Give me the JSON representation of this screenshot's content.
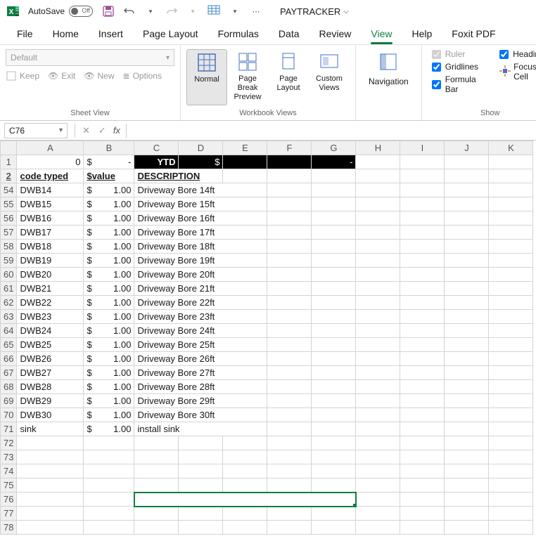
{
  "title": {
    "autosave_label": "AutoSave",
    "autosave_state": "Off",
    "doc_name": "PAYTRACKER"
  },
  "tabs": {
    "file": "File",
    "home": "Home",
    "insert": "Insert",
    "page_layout": "Page Layout",
    "formulas": "Formulas",
    "data": "Data",
    "review": "Review",
    "view": "View",
    "help": "Help",
    "foxit": "Foxit PDF"
  },
  "ribbon": {
    "sheet_view": {
      "dropdown_placeholder": "Default",
      "keep": "Keep",
      "exit": "Exit",
      "new": "New",
      "options": "Options",
      "label": "Sheet View"
    },
    "workbook_views": {
      "normal": "Normal",
      "page_break": "Page Break Preview",
      "page_layout": "Page Layout",
      "custom_views": "Custom Views",
      "label": "Workbook Views"
    },
    "navigation": {
      "btn": "Navigation"
    },
    "show": {
      "ruler": "Ruler",
      "gridlines": "Gridlines",
      "formula_bar": "Formula Bar",
      "headings": "Headings",
      "focus_cell": "Focus Cell",
      "label": "Show"
    }
  },
  "namebox": "C76",
  "columns": [
    "A",
    "B",
    "C",
    "D",
    "E",
    "F",
    "G",
    "H",
    "I",
    "J",
    "K"
  ],
  "row1": {
    "a": "0",
    "b_sym": "$",
    "b_val": "-",
    "ytd": "YTD",
    "ytd_sym": "$",
    "ytd_dash": "-"
  },
  "row2": {
    "code": "code typed",
    "value": "$value",
    "desc": "DESCRIPTION"
  },
  "data_rows": [
    {
      "row": 54,
      "code": "DWB14",
      "sym": "$",
      "val": "1.00",
      "desc": "Driveway Bore 14ft"
    },
    {
      "row": 55,
      "code": "DWB15",
      "sym": "$",
      "val": "1.00",
      "desc": "Driveway Bore 15ft"
    },
    {
      "row": 56,
      "code": "DWB16",
      "sym": "$",
      "val": "1.00",
      "desc": "Driveway Bore 16ft"
    },
    {
      "row": 57,
      "code": "DWB17",
      "sym": "$",
      "val": "1.00",
      "desc": "Driveway Bore 17ft"
    },
    {
      "row": 58,
      "code": "DWB18",
      "sym": "$",
      "val": "1.00",
      "desc": "Driveway Bore 18ft"
    },
    {
      "row": 59,
      "code": "DWB19",
      "sym": "$",
      "val": "1.00",
      "desc": "Driveway Bore 19ft"
    },
    {
      "row": 60,
      "code": "DWB20",
      "sym": "$",
      "val": "1.00",
      "desc": "Driveway Bore 20ft"
    },
    {
      "row": 61,
      "code": "DWB21",
      "sym": "$",
      "val": "1.00",
      "desc": "Driveway Bore 21ft"
    },
    {
      "row": 62,
      "code": "DWB22",
      "sym": "$",
      "val": "1.00",
      "desc": "Driveway Bore 22ft"
    },
    {
      "row": 63,
      "code": "DWB23",
      "sym": "$",
      "val": "1.00",
      "desc": "Driveway Bore 23ft"
    },
    {
      "row": 64,
      "code": "DWB24",
      "sym": "$",
      "val": "1.00",
      "desc": "Driveway Bore 24ft"
    },
    {
      "row": 65,
      "code": "DWB25",
      "sym": "$",
      "val": "1.00",
      "desc": "Driveway Bore 25ft"
    },
    {
      "row": 66,
      "code": "DWB26",
      "sym": "$",
      "val": "1.00",
      "desc": "Driveway Bore 26ft"
    },
    {
      "row": 67,
      "code": "DWB27",
      "sym": "$",
      "val": "1.00",
      "desc": "Driveway Bore 27ft"
    },
    {
      "row": 68,
      "code": "DWB28",
      "sym": "$",
      "val": "1.00",
      "desc": "Driveway Bore 28ft"
    },
    {
      "row": 69,
      "code": "DWB29",
      "sym": "$",
      "val": "1.00",
      "desc": "Driveway Bore 29ft"
    },
    {
      "row": 70,
      "code": "DWB30",
      "sym": "$",
      "val": "1.00",
      "desc": "Driveway Bore 30ft"
    },
    {
      "row": 71,
      "code": "sink",
      "sym": "$",
      "val": "1.00",
      "desc": "install sink"
    }
  ],
  "empty_rows": [
    72,
    73,
    74,
    75,
    76,
    77,
    78
  ],
  "selected_row": 76
}
